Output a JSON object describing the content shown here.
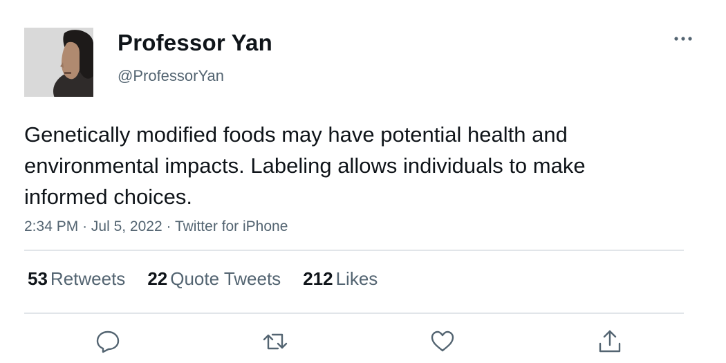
{
  "author": {
    "display_name": "Professor Yan",
    "handle": "@ProfessorYan"
  },
  "tweet": {
    "text": "Genetically modified foods may have potential health and environmental impacts. Labeling allows individuals to make informed choices.",
    "time": "2:34 PM",
    "date": "Jul 5, 2022",
    "source": "Twitter for iPhone",
    "separator": "·"
  },
  "stats": {
    "retweets": {
      "count": "53",
      "label": "Retweets"
    },
    "quote_tweets": {
      "count": "22",
      "label": "Quote Tweets"
    },
    "likes": {
      "count": "212",
      "label": "Likes"
    }
  },
  "icons": {
    "more": "more-horizontal-icon",
    "reply": "reply-icon",
    "retweet": "retweet-icon",
    "like": "heart-icon",
    "share": "share-icon"
  },
  "colors": {
    "text_primary": "#0f1419",
    "text_secondary": "#536471",
    "divider": "#e1e5e9"
  }
}
